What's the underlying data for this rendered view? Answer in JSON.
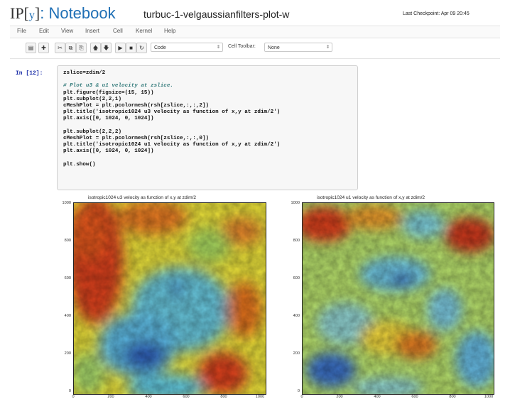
{
  "header": {
    "logo_left": "IP",
    "logo_bracket_open": "[",
    "logo_y": "y",
    "logo_bracket_close": "]",
    "logo_right": ": Notebook",
    "notebook_name": "turbuc-1-velgaussianfilters-plot-w",
    "checkpoint": "Last Checkpoint: Apr 09 20:45"
  },
  "menu": [
    "File",
    "Edit",
    "View",
    "Insert",
    "Cell",
    "Kernel",
    "Help"
  ],
  "toolbar": {
    "buttons": [
      "save-icon",
      "plus-icon",
      "cut-icon",
      "copy-icon",
      "paste-icon",
      "arrow-up-icon",
      "arrow-down-icon",
      "run-icon",
      "stop-icon",
      "restart-icon"
    ],
    "cell_type": "Code",
    "cell_toolbar_label": "Cell Toolbar:",
    "cell_toolbar_value": "None"
  },
  "cell": {
    "prompt": "In [12]:",
    "code": [
      "zslice=zdim/2",
      "",
      "# Plot u3 & u1 velocity at zslice.",
      "plt.figure(figsize=(15, 15))",
      "plt.subplot(2,2,1)",
      "cMeshPlot = plt.pcolormesh(rsh[zslice,:,:,2])",
      "plt.title('isotropic1024 u3 velocity as function of x,y at zdim/2')",
      "plt.axis([0, 1024, 0, 1024])",
      "",
      "plt.subplot(2,2,2)",
      "cMeshPlot = plt.pcolormesh(rsh[zslice,:,:,0])",
      "plt.title('isotropic1024 u1 velocity as function of x,y at zdim/2')",
      "plt.axis([0, 1024, 0, 1024])",
      "",
      "plt.show()"
    ]
  },
  "plots": [
    {
      "title": "isotropic1024 u3 velocity as function of x,y at zdim/2",
      "yticks": [
        "1000",
        "800",
        "600",
        "400",
        "200",
        "0"
      ],
      "xticks": [
        "0",
        "200",
        "400",
        "600",
        "800",
        "1000"
      ]
    },
    {
      "title": "isotropic1024 u1 velocity as function of x,y at zdim/2",
      "yticks": [
        "1000",
        "800",
        "600",
        "400",
        "200",
        "0"
      ],
      "xticks": [
        "0",
        "200",
        "400",
        "600",
        "800",
        "1000"
      ]
    }
  ],
  "colors": {
    "brand_blue": "#1f6fb5",
    "prompt_blue": "#1b2ea8",
    "code_string": "#b01515",
    "code_comment": "#3a7f7f",
    "jet_red": "#d7301f",
    "jet_yellow": "#f2e32a",
    "jet_cyan": "#5bc4e6",
    "jet_blue": "#2e5fb8"
  }
}
